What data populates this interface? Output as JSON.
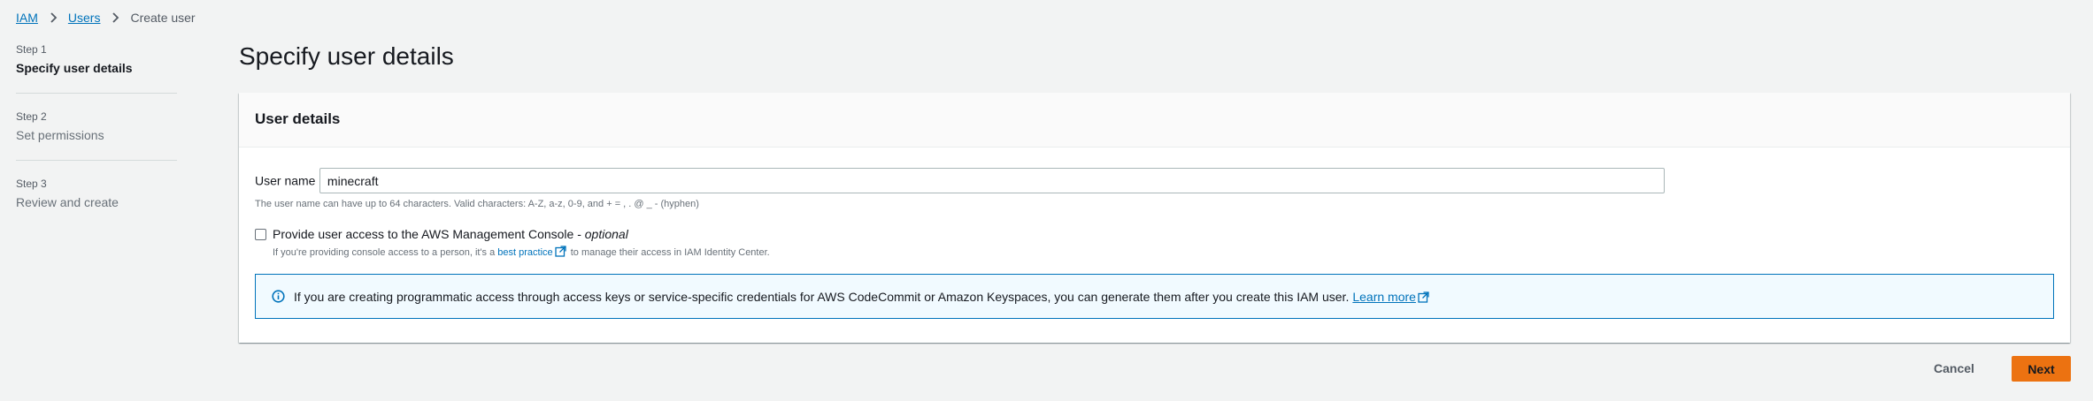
{
  "breadcrumb": {
    "items": [
      {
        "label": "IAM"
      },
      {
        "label": "Users"
      }
    ],
    "current": "Create user"
  },
  "steps": [
    {
      "number": "Step 1",
      "title": "Specify user details"
    },
    {
      "number": "Step 2",
      "title": "Set permissions"
    },
    {
      "number": "Step 3",
      "title": "Review and create"
    }
  ],
  "page": {
    "title": "Specify user details"
  },
  "user_details": {
    "header": "User details",
    "username_label": "User name",
    "username_value": "minecraft",
    "username_hint": "The user name can have up to 64 characters. Valid characters: A-Z, a-z, 0-9, and + = , . @ _ - (hyphen)",
    "console_access": {
      "label": "Provide user access to the AWS Management Console - ",
      "optional": "optional",
      "checked": false,
      "desc_before": "If you're providing console access to a person, it's a ",
      "desc_link": "best practice",
      "desc_after": " to manage their access in IAM Identity Center."
    },
    "info_alert": {
      "message": "If you are creating programmatic access through access keys or service-specific credentials for AWS CodeCommit or Amazon Keyspaces, you can generate them after you create this IAM user.",
      "link": "Learn more"
    }
  },
  "footer": {
    "cancel_label": "Cancel",
    "next_label": "Next"
  },
  "colors": {
    "link": "#0073bb",
    "primary_button": "#ec7211",
    "page_background": "#f2f3f3",
    "info_border": "#0073bb"
  },
  "icons": {
    "breadcrumb_separator": "chevron-right-icon",
    "external_link": "external-link-icon",
    "info": "info-icon"
  }
}
